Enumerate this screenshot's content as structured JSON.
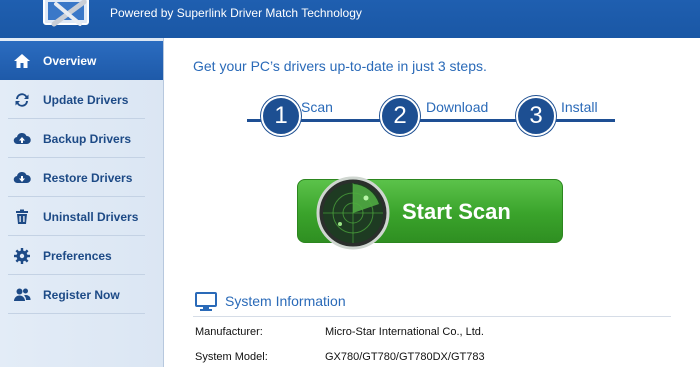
{
  "header": {
    "tagline": "Powered by Superlink Driver Match Technology"
  },
  "sidebar": {
    "items": [
      {
        "label": "Overview",
        "icon": "home-icon",
        "active": true
      },
      {
        "label": "Update Drivers",
        "icon": "refresh-icon",
        "active": false
      },
      {
        "label": "Backup Drivers",
        "icon": "cloud-upload-icon",
        "active": false
      },
      {
        "label": "Restore Drivers",
        "icon": "restore-icon",
        "active": false
      },
      {
        "label": "Uninstall Drivers",
        "icon": "trash-icon",
        "active": false
      },
      {
        "label": "Preferences",
        "icon": "gear-icon",
        "active": false
      },
      {
        "label": "Register Now",
        "icon": "users-icon",
        "active": false
      }
    ]
  },
  "main": {
    "title": "Get your PC’s drivers up-to-date in just 3 steps.",
    "steps": [
      {
        "number": "1",
        "label": "Scan"
      },
      {
        "number": "2",
        "label": "Download"
      },
      {
        "number": "3",
        "label": "Install"
      }
    ],
    "scan_button": "Start Scan",
    "system_info": {
      "title": "System Information",
      "rows": [
        {
          "label": "Manufacturer:",
          "value": "Micro-Star International Co., Ltd."
        },
        {
          "label": "System Model:",
          "value": "GX780/GT780/GT780DX/GT783"
        }
      ]
    }
  },
  "colors": {
    "header": "#1f5fb0",
    "accent_text": "#2a6ab8",
    "sidebar_text": "#1d4a86",
    "step_circle": "#1d4f92",
    "scan_button": "#3aa32b"
  }
}
